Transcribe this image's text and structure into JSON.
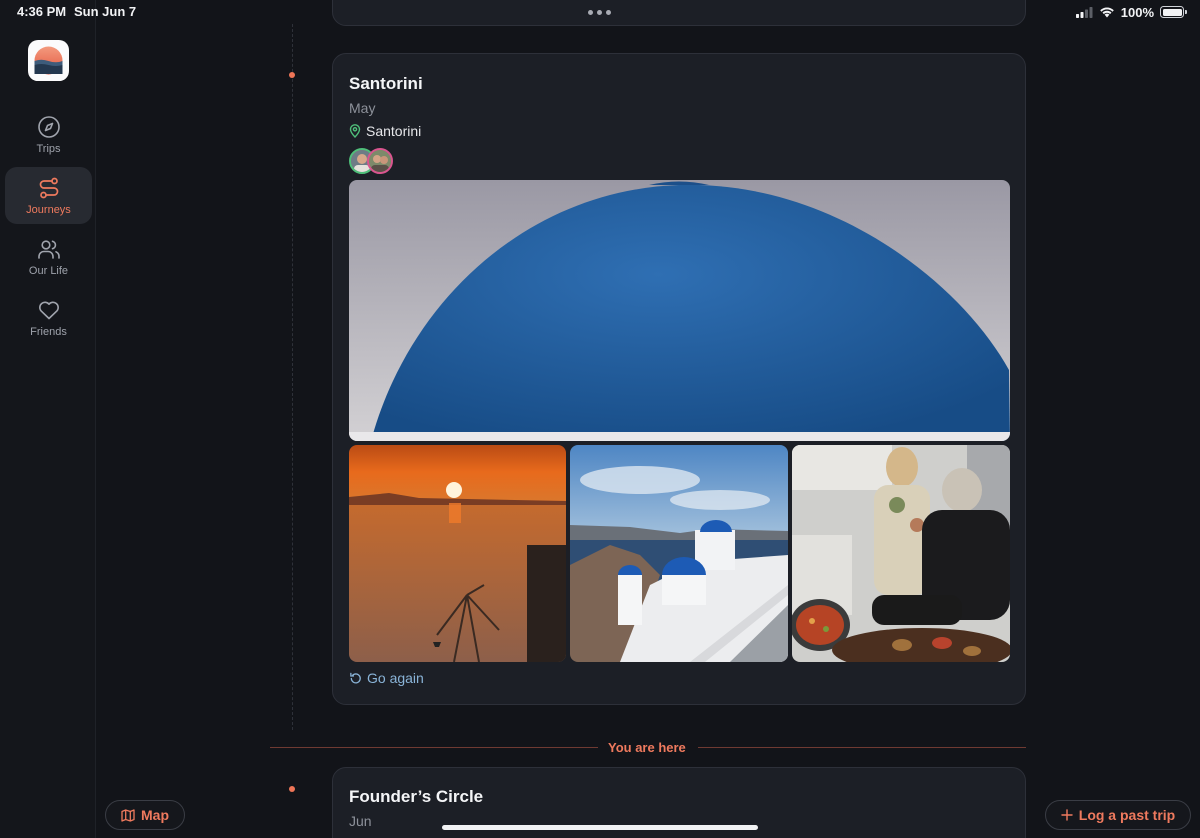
{
  "status_bar": {
    "time": "4:36 PM",
    "date": "Sun Jun 7",
    "battery": "100%"
  },
  "sidebar": {
    "items": [
      {
        "label": "Trips",
        "icon": "compass-icon",
        "active": false
      },
      {
        "label": "Journeys",
        "icon": "route-icon",
        "active": true
      },
      {
        "label": "Our Life",
        "icon": "people-icon",
        "active": false
      },
      {
        "label": "Friends",
        "icon": "heart-icon",
        "active": false
      }
    ]
  },
  "trip_card": {
    "title": "Santorini",
    "month": "May",
    "location": "Santorini",
    "action": "Go again"
  },
  "divider": {
    "label": "You are here"
  },
  "next_card": {
    "title": "Founder’s Circle",
    "month": "Jun"
  },
  "buttons": {
    "map": "Map",
    "log": "Log a past trip"
  },
  "colors": {
    "accent": "#ef7a5e",
    "background": "#121419",
    "card": "#1c1f26",
    "link": "#8ab4d8"
  }
}
